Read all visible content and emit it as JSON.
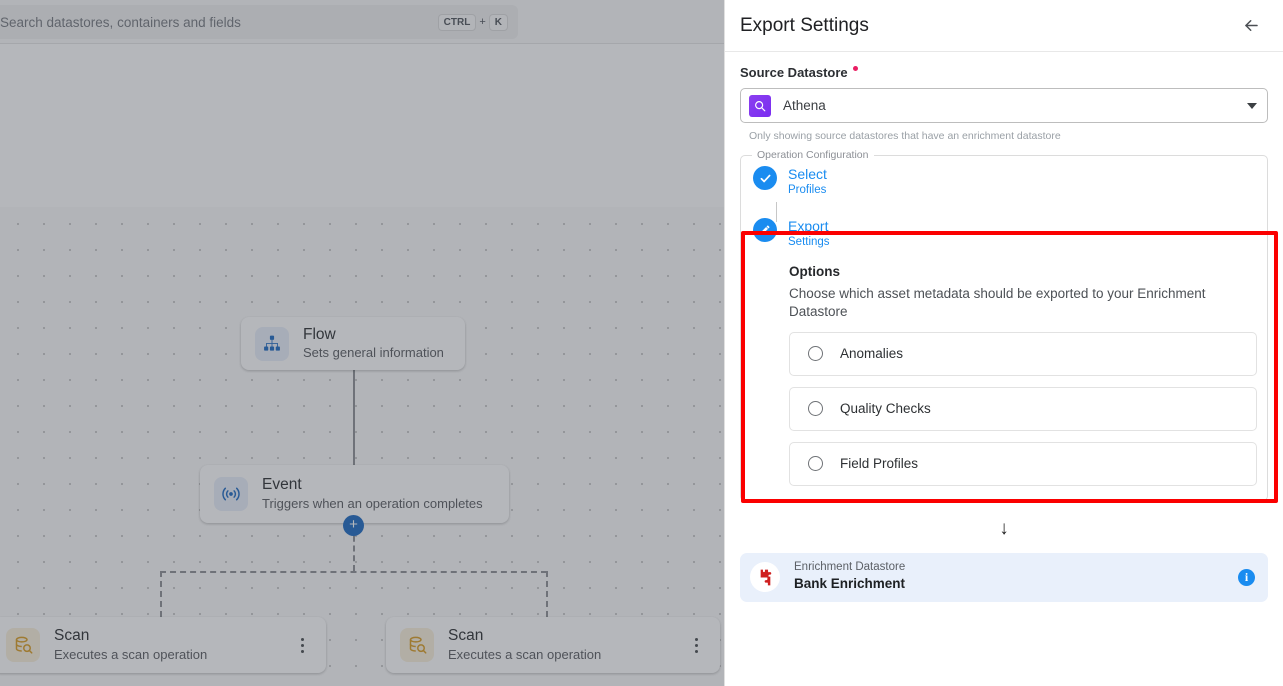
{
  "canvas": {
    "search": {
      "placeholder": "Search datastores, containers and fields",
      "shortcut_key_1": "CTRL",
      "shortcut_plus": "+",
      "shortcut_key_2": "K"
    },
    "nodes": [
      {
        "title": "Flow",
        "subtitle": "Sets general information",
        "icon": "sitemap-icon",
        "has_menu": false
      },
      {
        "title": "Event",
        "subtitle": "Triggers when an operation completes",
        "icon": "broadcast-icon",
        "has_menu": false
      },
      {
        "title": "Scan",
        "subtitle": "Executes a scan operation",
        "icon": "database-search-icon",
        "has_menu": true
      },
      {
        "title": "Scan",
        "subtitle": "Executes a scan operation",
        "icon": "database-search-icon",
        "has_menu": true
      }
    ],
    "add_node_label": "+"
  },
  "panel": {
    "title": "Export Settings",
    "back_icon": "arrow-left-icon",
    "source_datastore": {
      "label": "Source Datastore",
      "required": true,
      "selected_value": "Athena",
      "selected_icon": "athena-icon",
      "hint": "Only showing source datastores that have an enrichment datastore"
    },
    "operation_configuration": {
      "legend": "Operation Configuration",
      "steps": [
        {
          "main": "Select",
          "sub": "Profiles",
          "state": "complete",
          "icon": "check-icon"
        },
        {
          "main": "Export",
          "sub": "Settings",
          "state": "active",
          "icon": "pencil-icon"
        }
      ],
      "options": {
        "title": "Options",
        "description": "Choose which asset metadata should be exported to your Enrichment Datastore",
        "items": [
          {
            "label": "Anomalies",
            "selected": false
          },
          {
            "label": "Quality Checks",
            "selected": false
          },
          {
            "label": "Field Profiles",
            "selected": false
          }
        ]
      }
    },
    "flow_arrow": "↓",
    "enrichment_datastore": {
      "kicker": "Enrichment Datastore",
      "name": "Bank Enrichment",
      "icon": "enrichment-datastore-icon",
      "info_icon": "info-icon",
      "info_glyph": "i"
    }
  },
  "colors": {
    "accent_blue": "#1a8cf0",
    "highlight_red": "#fb0000",
    "required_pink": "#e91e63",
    "enrichment_card_bg": "#e9f0fb"
  }
}
